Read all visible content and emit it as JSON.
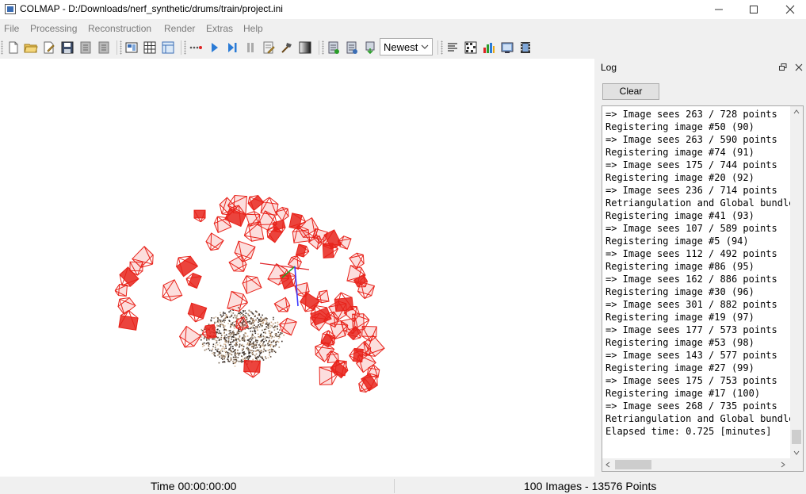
{
  "window": {
    "title": "COLMAP - D:/Downloads/nerf_synthetic/drums/train/project.ini",
    "minimize_icon": "minimize-icon",
    "maximize_icon": "maximize-icon",
    "close_icon": "close-icon"
  },
  "menu": [
    "File",
    "Processing",
    "Reconstruction",
    "Render",
    "Extras",
    "Help"
  ],
  "toolbar": {
    "icons": [
      "new-project-icon",
      "open-project-icon",
      "edit-project-icon",
      "save-project-icon",
      "import-icon",
      "export-icon",
      "feature-extraction-icon",
      "feature-matching-icon",
      "database-icon",
      "automatic-reconstruction-icon",
      "start-reconstruction-icon",
      "step-icon",
      "pause-icon",
      "reconstruction-options-icon",
      "bundle-adjustment-icon",
      "dense-reconstruction-icon",
      "render-options-icon",
      "model-stats-icon",
      "grab-image-icon",
      "show-log-icon",
      "match-matrix-icon",
      "reconstruction-stats-icon",
      "grab-movie-icon",
      "movie-icon"
    ],
    "reconstruction_selector": "Newest"
  },
  "log": {
    "title": "Log",
    "clear_label": "Clear",
    "lines": [
      "=> Image sees 263 / 728 points",
      "Registering image #50 (90)",
      "=> Image sees 263 / 590 points",
      "Registering image #74 (91)",
      "=> Image sees 175 / 744 points",
      "Registering image #20 (92)",
      "=> Image sees 236 / 714 points",
      "Retriangulation and Global bundle adjustment",
      "Registering image #41 (93)",
      "=> Image sees 107 / 589 points",
      "Registering image #5 (94)",
      "=> Image sees 112 / 492 points",
      "Registering image #86 (95)",
      "=> Image sees 162 / 886 points",
      "Registering image #30 (96)",
      "=> Image sees 301 / 882 points",
      "Registering image #19 (97)",
      "=> Image sees 177 / 573 points",
      "Registering image #53 (98)",
      "=> Image sees 143 / 577 points",
      "Registering image #27 (99)",
      "=> Image sees 175 / 753 points",
      "Registering image #17 (100)",
      "=> Image sees 268 / 735 points",
      "Retriangulation and Global bundle adjustment",
      "Elapsed time: 0.725 [minutes]"
    ]
  },
  "status": {
    "time": "Time 00:00:00:00",
    "counts": "100 Images - 13576 Points"
  },
  "colors": {
    "camera": "#e8231b",
    "axis_x": "#e0262b",
    "axis_y": "#2a9d2a",
    "axis_z": "#3b3bff"
  }
}
